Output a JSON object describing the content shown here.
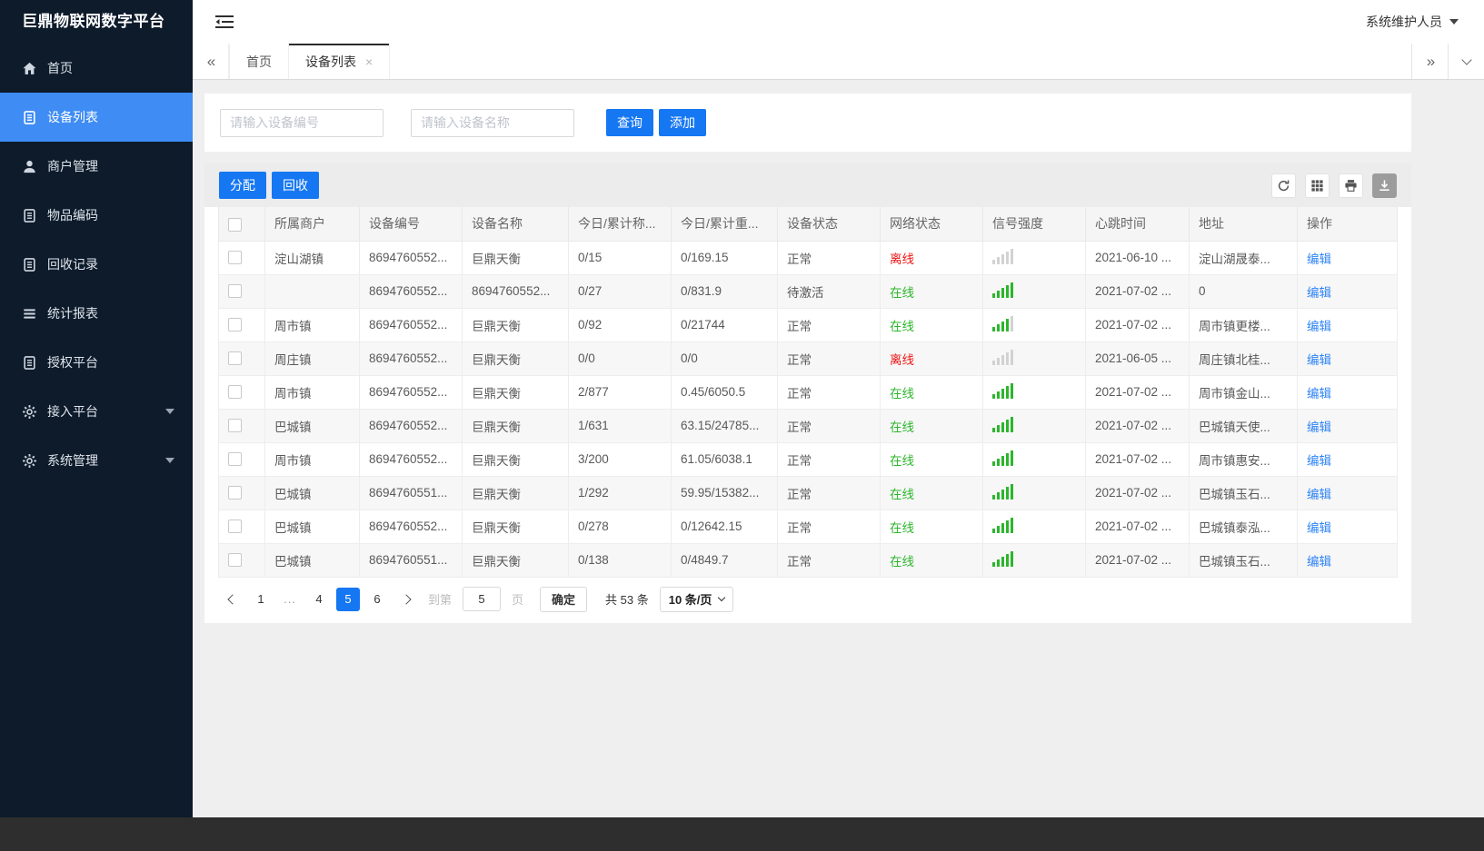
{
  "app": {
    "title": "巨鼎物联网数字平台",
    "user": "系统维护人员"
  },
  "sidebar": {
    "items": [
      {
        "label": "首页",
        "icon": "home-icon",
        "active": false
      },
      {
        "label": "设备列表",
        "icon": "document-icon",
        "active": true
      },
      {
        "label": "商户管理",
        "icon": "user-icon",
        "active": false
      },
      {
        "label": "物品编码",
        "icon": "document-icon",
        "active": false
      },
      {
        "label": "回收记录",
        "icon": "document-icon",
        "active": false
      },
      {
        "label": "统计报表",
        "icon": "list-icon",
        "active": false
      },
      {
        "label": "授权平台",
        "icon": "document-icon",
        "active": false
      },
      {
        "label": "接入平台",
        "icon": "gear-icon",
        "active": false,
        "expandable": true
      },
      {
        "label": "系统管理",
        "icon": "gear-icon",
        "active": false,
        "expandable": true
      }
    ]
  },
  "tabs": {
    "items": [
      {
        "label": "首页",
        "active": false,
        "closable": false
      },
      {
        "label": "设备列表",
        "active": true,
        "closable": true
      }
    ]
  },
  "search": {
    "device_no_placeholder": "请输入设备编号",
    "device_name_placeholder": "请输入设备名称",
    "query_label": "查询",
    "add_label": "添加"
  },
  "toolbar": {
    "assign_label": "分配",
    "recycle_label": "回收",
    "icons": [
      "refresh-icon",
      "grid-icon",
      "printer-icon",
      "download-icon"
    ]
  },
  "table": {
    "columns": [
      "所属商户",
      "设备编号",
      "设备名称",
      "今日/累计称...",
      "今日/累计重...",
      "设备状态",
      "网络状态",
      "信号强度",
      "心跳时间",
      "地址",
      "操作"
    ],
    "edit_label": "编辑",
    "rows": [
      {
        "merchant": "淀山湖镇",
        "device_no": "8694760552...",
        "device_name": "巨鼎天衡",
        "today_count": "0/15",
        "today_weight": "0/169.15",
        "status": "正常",
        "network": "离线",
        "online": false,
        "signal_green": 0,
        "heartbeat": "2021-06-10 ...",
        "address": "淀山湖晟泰..."
      },
      {
        "merchant": "",
        "device_no": "8694760552...",
        "device_name": "8694760552...",
        "today_count": "0/27",
        "today_weight": "0/831.9",
        "status": "待激活",
        "network": "在线",
        "online": true,
        "signal_green": 5,
        "heartbeat": "2021-07-02 ...",
        "address": "0"
      },
      {
        "merchant": "周市镇",
        "device_no": "8694760552...",
        "device_name": "巨鼎天衡",
        "today_count": "0/92",
        "today_weight": "0/21744",
        "status": "正常",
        "network": "在线",
        "online": true,
        "signal_green": 4,
        "heartbeat": "2021-07-02 ...",
        "address": "周市镇更楼..."
      },
      {
        "merchant": "周庄镇",
        "device_no": "8694760552...",
        "device_name": "巨鼎天衡",
        "today_count": "0/0",
        "today_weight": "0/0",
        "status": "正常",
        "network": "离线",
        "online": false,
        "signal_green": 0,
        "heartbeat": "2021-06-05 ...",
        "address": "周庄镇北桂..."
      },
      {
        "merchant": "周市镇",
        "device_no": "8694760552...",
        "device_name": "巨鼎天衡",
        "today_count": "2/877",
        "today_weight": "0.45/6050.5",
        "status": "正常",
        "network": "在线",
        "online": true,
        "signal_green": 5,
        "heartbeat": "2021-07-02 ...",
        "address": "周市镇金山..."
      },
      {
        "merchant": "巴城镇",
        "device_no": "8694760552...",
        "device_name": "巨鼎天衡",
        "today_count": "1/631",
        "today_weight": "63.15/24785...",
        "status": "正常",
        "network": "在线",
        "online": true,
        "signal_green": 5,
        "heartbeat": "2021-07-02 ...",
        "address": "巴城镇天使..."
      },
      {
        "merchant": "周市镇",
        "device_no": "8694760552...",
        "device_name": "巨鼎天衡",
        "today_count": "3/200",
        "today_weight": "61.05/6038.1",
        "status": "正常",
        "network": "在线",
        "online": true,
        "signal_green": 5,
        "heartbeat": "2021-07-02 ...",
        "address": "周市镇惠安..."
      },
      {
        "merchant": "巴城镇",
        "device_no": "8694760551...",
        "device_name": "巨鼎天衡",
        "today_count": "1/292",
        "today_weight": "59.95/15382...",
        "status": "正常",
        "network": "在线",
        "online": true,
        "signal_green": 5,
        "heartbeat": "2021-07-02 ...",
        "address": "巴城镇玉石..."
      },
      {
        "merchant": "巴城镇",
        "device_no": "8694760552...",
        "device_name": "巨鼎天衡",
        "today_count": "0/278",
        "today_weight": "0/12642.15",
        "status": "正常",
        "network": "在线",
        "online": true,
        "signal_green": 5,
        "heartbeat": "2021-07-02 ...",
        "address": "巴城镇泰泓..."
      },
      {
        "merchant": "巴城镇",
        "device_no": "8694760551...",
        "device_name": "巨鼎天衡",
        "today_count": "0/138",
        "today_weight": "0/4849.7",
        "status": "正常",
        "network": "在线",
        "online": true,
        "signal_green": 5,
        "heartbeat": "2021-07-02 ...",
        "address": "巴城镇玉石..."
      }
    ]
  },
  "pagination": {
    "pages": [
      "1",
      "...",
      "4",
      "5",
      "6"
    ],
    "active_page": "5",
    "goto_label": "到第",
    "goto_value": "5",
    "page_unit_label": "页",
    "confirm_label": "确定",
    "total_label": "共 53 条",
    "page_size_label": "10 条/页"
  },
  "colors": {
    "accent_blue": "#1677f2",
    "sidebar_active_blue": "#3e8cf4",
    "online_green": "#2cb52c",
    "offline_red": "#f01414",
    "signal_gray": "#d2d2d2"
  }
}
